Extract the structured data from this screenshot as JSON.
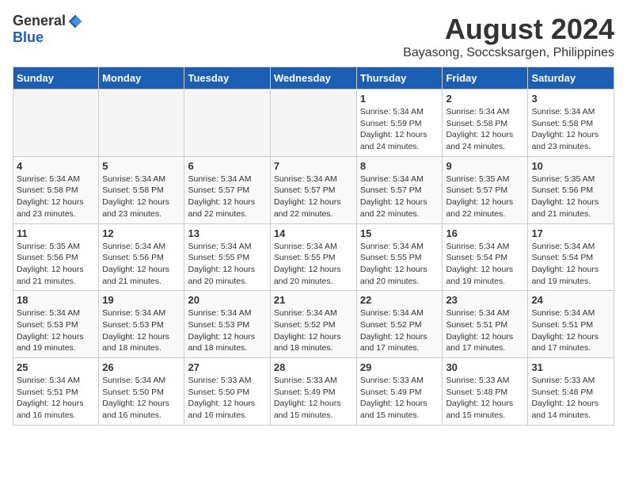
{
  "logo": {
    "general": "General",
    "blue": "Blue"
  },
  "title": {
    "month": "August 2024",
    "location": "Bayasong, Soccsksargen, Philippines"
  },
  "weekdays": [
    "Sunday",
    "Monday",
    "Tuesday",
    "Wednesday",
    "Thursday",
    "Friday",
    "Saturday"
  ],
  "weeks": [
    [
      {
        "day": "",
        "empty": true
      },
      {
        "day": "",
        "empty": true
      },
      {
        "day": "",
        "empty": true
      },
      {
        "day": "",
        "empty": true
      },
      {
        "day": "1",
        "sunrise": "Sunrise: 5:34 AM",
        "sunset": "Sunset: 5:59 PM",
        "daylight": "Daylight: 12 hours and 24 minutes."
      },
      {
        "day": "2",
        "sunrise": "Sunrise: 5:34 AM",
        "sunset": "Sunset: 5:58 PM",
        "daylight": "Daylight: 12 hours and 24 minutes."
      },
      {
        "day": "3",
        "sunrise": "Sunrise: 5:34 AM",
        "sunset": "Sunset: 5:58 PM",
        "daylight": "Daylight: 12 hours and 23 minutes."
      }
    ],
    [
      {
        "day": "4",
        "sunrise": "Sunrise: 5:34 AM",
        "sunset": "Sunset: 5:58 PM",
        "daylight": "Daylight: 12 hours and 23 minutes."
      },
      {
        "day": "5",
        "sunrise": "Sunrise: 5:34 AM",
        "sunset": "Sunset: 5:58 PM",
        "daylight": "Daylight: 12 hours and 23 minutes."
      },
      {
        "day": "6",
        "sunrise": "Sunrise: 5:34 AM",
        "sunset": "Sunset: 5:57 PM",
        "daylight": "Daylight: 12 hours and 22 minutes."
      },
      {
        "day": "7",
        "sunrise": "Sunrise: 5:34 AM",
        "sunset": "Sunset: 5:57 PM",
        "daylight": "Daylight: 12 hours and 22 minutes."
      },
      {
        "day": "8",
        "sunrise": "Sunrise: 5:34 AM",
        "sunset": "Sunset: 5:57 PM",
        "daylight": "Daylight: 12 hours and 22 minutes."
      },
      {
        "day": "9",
        "sunrise": "Sunrise: 5:35 AM",
        "sunset": "Sunset: 5:57 PM",
        "daylight": "Daylight: 12 hours and 22 minutes."
      },
      {
        "day": "10",
        "sunrise": "Sunrise: 5:35 AM",
        "sunset": "Sunset: 5:56 PM",
        "daylight": "Daylight: 12 hours and 21 minutes."
      }
    ],
    [
      {
        "day": "11",
        "sunrise": "Sunrise: 5:35 AM",
        "sunset": "Sunset: 5:56 PM",
        "daylight": "Daylight: 12 hours and 21 minutes."
      },
      {
        "day": "12",
        "sunrise": "Sunrise: 5:34 AM",
        "sunset": "Sunset: 5:56 PM",
        "daylight": "Daylight: 12 hours and 21 minutes."
      },
      {
        "day": "13",
        "sunrise": "Sunrise: 5:34 AM",
        "sunset": "Sunset: 5:55 PM",
        "daylight": "Daylight: 12 hours and 20 minutes."
      },
      {
        "day": "14",
        "sunrise": "Sunrise: 5:34 AM",
        "sunset": "Sunset: 5:55 PM",
        "daylight": "Daylight: 12 hours and 20 minutes."
      },
      {
        "day": "15",
        "sunrise": "Sunrise: 5:34 AM",
        "sunset": "Sunset: 5:55 PM",
        "daylight": "Daylight: 12 hours and 20 minutes."
      },
      {
        "day": "16",
        "sunrise": "Sunrise: 5:34 AM",
        "sunset": "Sunset: 5:54 PM",
        "daylight": "Daylight: 12 hours and 19 minutes."
      },
      {
        "day": "17",
        "sunrise": "Sunrise: 5:34 AM",
        "sunset": "Sunset: 5:54 PM",
        "daylight": "Daylight: 12 hours and 19 minutes."
      }
    ],
    [
      {
        "day": "18",
        "sunrise": "Sunrise: 5:34 AM",
        "sunset": "Sunset: 5:53 PM",
        "daylight": "Daylight: 12 hours and 19 minutes."
      },
      {
        "day": "19",
        "sunrise": "Sunrise: 5:34 AM",
        "sunset": "Sunset: 5:53 PM",
        "daylight": "Daylight: 12 hours and 18 minutes."
      },
      {
        "day": "20",
        "sunrise": "Sunrise: 5:34 AM",
        "sunset": "Sunset: 5:53 PM",
        "daylight": "Daylight: 12 hours and 18 minutes."
      },
      {
        "day": "21",
        "sunrise": "Sunrise: 5:34 AM",
        "sunset": "Sunset: 5:52 PM",
        "daylight": "Daylight: 12 hours and 18 minutes."
      },
      {
        "day": "22",
        "sunrise": "Sunrise: 5:34 AM",
        "sunset": "Sunset: 5:52 PM",
        "daylight": "Daylight: 12 hours and 17 minutes."
      },
      {
        "day": "23",
        "sunrise": "Sunrise: 5:34 AM",
        "sunset": "Sunset: 5:51 PM",
        "daylight": "Daylight: 12 hours and 17 minutes."
      },
      {
        "day": "24",
        "sunrise": "Sunrise: 5:34 AM",
        "sunset": "Sunset: 5:51 PM",
        "daylight": "Daylight: 12 hours and 17 minutes."
      }
    ],
    [
      {
        "day": "25",
        "sunrise": "Sunrise: 5:34 AM",
        "sunset": "Sunset: 5:51 PM",
        "daylight": "Daylight: 12 hours and 16 minutes."
      },
      {
        "day": "26",
        "sunrise": "Sunrise: 5:34 AM",
        "sunset": "Sunset: 5:50 PM",
        "daylight": "Daylight: 12 hours and 16 minutes."
      },
      {
        "day": "27",
        "sunrise": "Sunrise: 5:33 AM",
        "sunset": "Sunset: 5:50 PM",
        "daylight": "Daylight: 12 hours and 16 minutes."
      },
      {
        "day": "28",
        "sunrise": "Sunrise: 5:33 AM",
        "sunset": "Sunset: 5:49 PM",
        "daylight": "Daylight: 12 hours and 15 minutes."
      },
      {
        "day": "29",
        "sunrise": "Sunrise: 5:33 AM",
        "sunset": "Sunset: 5:49 PM",
        "daylight": "Daylight: 12 hours and 15 minutes."
      },
      {
        "day": "30",
        "sunrise": "Sunrise: 5:33 AM",
        "sunset": "Sunset: 5:48 PM",
        "daylight": "Daylight: 12 hours and 15 minutes."
      },
      {
        "day": "31",
        "sunrise": "Sunrise: 5:33 AM",
        "sunset": "Sunset: 5:48 PM",
        "daylight": "Daylight: 12 hours and 14 minutes."
      }
    ]
  ]
}
